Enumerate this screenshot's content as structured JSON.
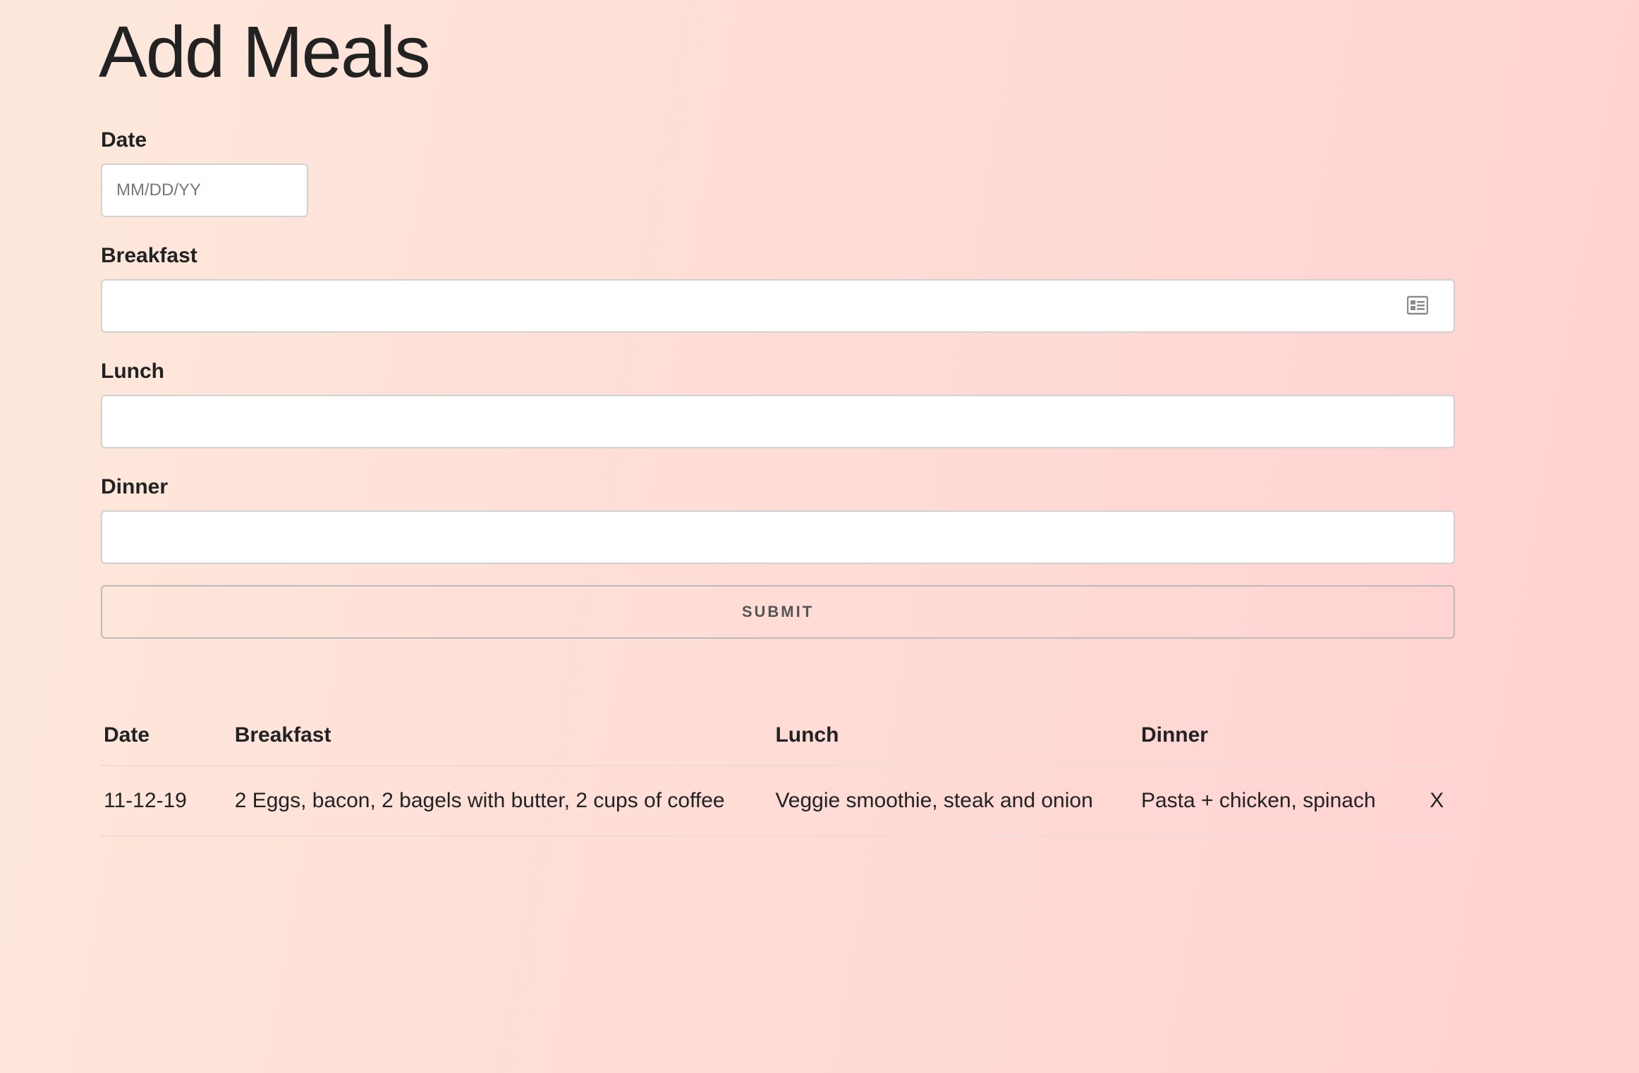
{
  "page": {
    "title": "Add Meals"
  },
  "form": {
    "date": {
      "label": "Date",
      "placeholder": "MM/DD/YY",
      "value": ""
    },
    "breakfast": {
      "label": "Breakfast",
      "value": "",
      "icon": "contact-card-icon"
    },
    "lunch": {
      "label": "Lunch",
      "value": ""
    },
    "dinner": {
      "label": "Dinner",
      "value": ""
    },
    "submit_label": "SUBMIT"
  },
  "table": {
    "headers": [
      "Date",
      "Breakfast",
      "Lunch",
      "Dinner",
      ""
    ],
    "rows": [
      {
        "date": "11-12-19",
        "breakfast": "2 Eggs, bacon, 2 bagels with butter, 2 cups of coffee",
        "lunch": "Veggie smoothie, steak and onion",
        "dinner": "Pasta + chicken, spinach",
        "delete_label": "X"
      }
    ]
  },
  "colors": {
    "background_start": "#fde9dc",
    "background_end": "#ffd1d1",
    "text": "#222222",
    "input_border": "#d1d1d1"
  }
}
